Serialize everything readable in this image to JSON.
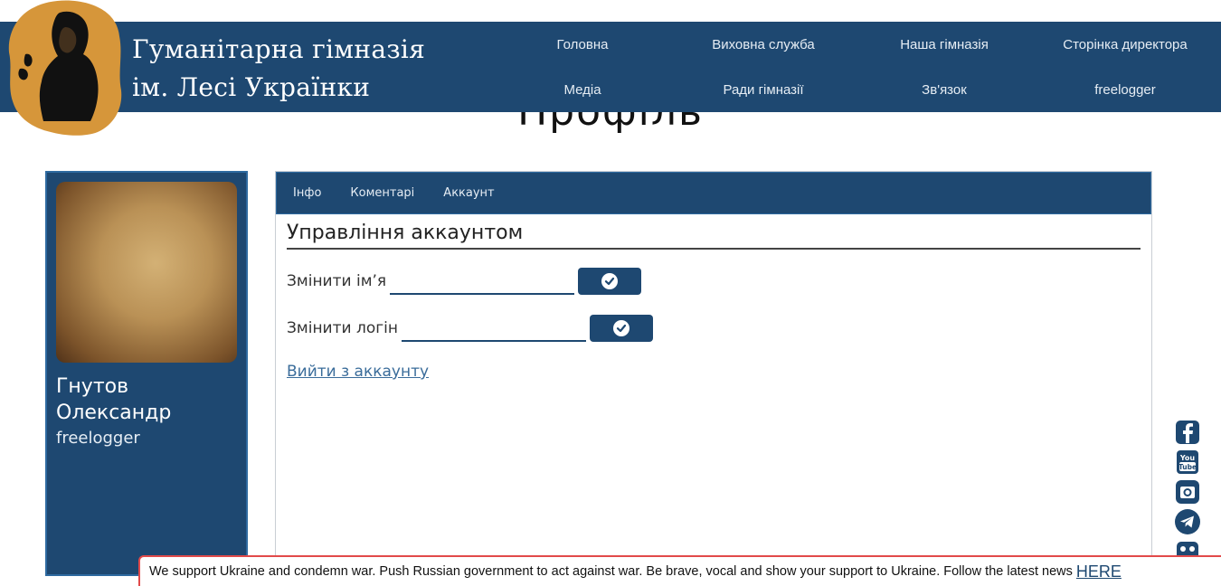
{
  "header": {
    "school_name_line1": "Гуманітарна гімназія",
    "school_name_line2": "ім. Лесі Українки",
    "logo_icon": "poet-portrait-logo",
    "nav": [
      "Головна",
      "Виховна служба",
      "Наша гімназія",
      "Сторінка директора",
      "Медіа",
      "Ради гімназії",
      "Зв'язок",
      "freelogger"
    ]
  },
  "page": {
    "title": "Профіль"
  },
  "profile": {
    "name": "Гнутов Олександр",
    "login": "freelogger"
  },
  "tabs": [
    "Інфо",
    "Коментарі",
    "Аккаунт"
  ],
  "account": {
    "section_title": "Управління аккаунтом",
    "change_name_label": "Змінити ім’я",
    "change_name_value": "",
    "change_login_label": "Змінити логін",
    "change_login_value": "",
    "confirm_icon": "check-circle-icon",
    "logout_label": "Вийти з аккаунту"
  },
  "social": [
    "facebook-icon",
    "youtube-icon",
    "instagram-icon",
    "telegram-icon",
    "viber-icon"
  ],
  "banner": {
    "text": "We support Ukraine and condemn war. Push Russian government to act against war. Be brave, vocal and show your support to Ukraine. Follow the latest news",
    "link": "HERE"
  },
  "colors": {
    "primary": "#1e4871",
    "logo_bg": "#d6963a",
    "banner_border": "#e24a4a"
  }
}
